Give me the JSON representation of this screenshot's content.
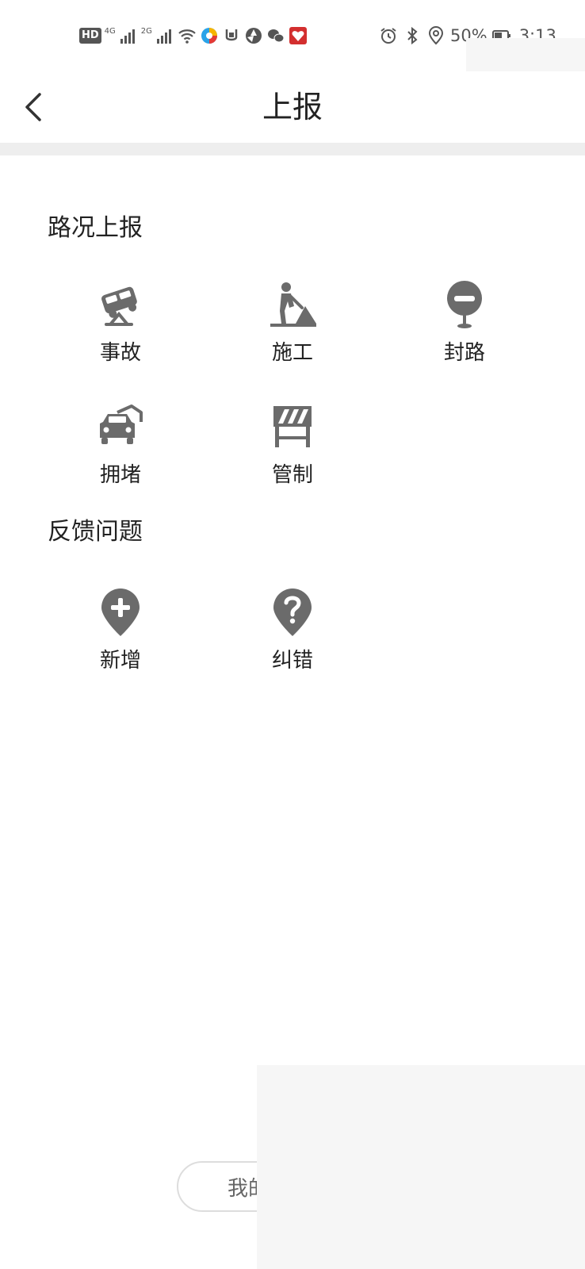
{
  "status_bar": {
    "left_badges": [
      "HD",
      "4G",
      "2G"
    ],
    "battery": "50%",
    "time": "3:13"
  },
  "header": {
    "title": "上报"
  },
  "sections": [
    {
      "title": "路况上报",
      "items": [
        {
          "label": "事故",
          "icon": "accident-icon"
        },
        {
          "label": "施工",
          "icon": "construction-icon"
        },
        {
          "label": "封路",
          "icon": "road-closed-icon"
        },
        {
          "label": "拥堵",
          "icon": "traffic-jam-icon"
        },
        {
          "label": "管制",
          "icon": "traffic-control-icon"
        }
      ]
    },
    {
      "title": "反馈问题",
      "items": [
        {
          "label": "新增",
          "icon": "add-place-icon"
        },
        {
          "label": "纠错",
          "icon": "correction-icon"
        }
      ]
    }
  ],
  "footer": {
    "my_reports_label": "我的"
  },
  "colors": {
    "icon_gray": "#6b6b6b",
    "divider": "#eeeeee",
    "text": "#222222"
  }
}
